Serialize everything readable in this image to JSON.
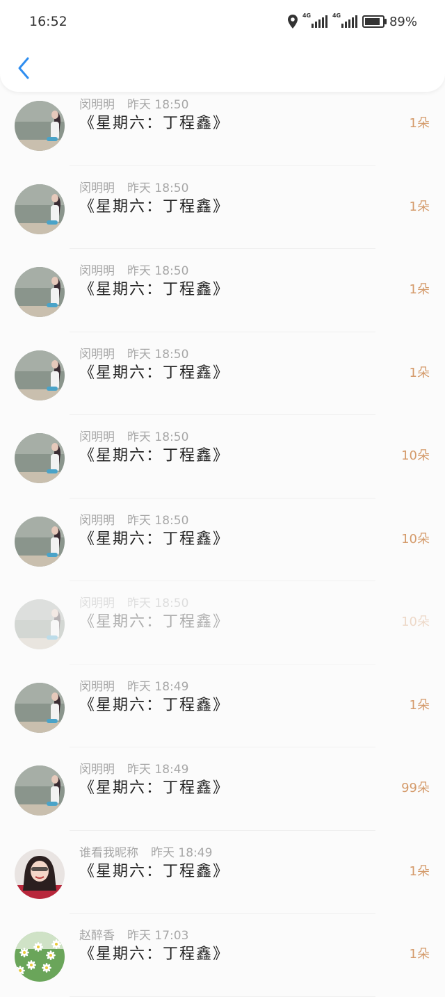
{
  "status": {
    "time": "16:52",
    "net1": "4G",
    "net2": "4G",
    "battery_pct": 89,
    "battery_text": "89%"
  },
  "header": {
    "back_icon": "chevron-left-icon"
  },
  "items": [
    {
      "name": "闵明明",
      "time": "昨天 18:50",
      "title": "《星期六：丁程鑫》",
      "count": "1朵",
      "avatar": "sea-girl"
    },
    {
      "name": "闵明明",
      "time": "昨天 18:50",
      "title": "《星期六：丁程鑫》",
      "count": "1朵",
      "avatar": "sea-girl"
    },
    {
      "name": "闵明明",
      "time": "昨天 18:50",
      "title": "《星期六：丁程鑫》",
      "count": "1朵",
      "avatar": "sea-girl"
    },
    {
      "name": "闵明明",
      "time": "昨天 18:50",
      "title": "《星期六：丁程鑫》",
      "count": "1朵",
      "avatar": "sea-girl"
    },
    {
      "name": "闵明明",
      "time": "昨天 18:50",
      "title": "《星期六：丁程鑫》",
      "count": "10朵",
      "avatar": "sea-girl"
    },
    {
      "name": "闵明明",
      "time": "昨天 18:50",
      "title": "《星期六：丁程鑫》",
      "count": "10朵",
      "avatar": "sea-girl"
    },
    {
      "name": "闵明明",
      "time": "昨天 18:50",
      "title": "《星期六：丁程鑫》",
      "count": "10朵",
      "avatar": "sea-girl",
      "faded": true
    },
    {
      "name": "闵明明",
      "time": "昨天 18:49",
      "title": "《星期六：丁程鑫》",
      "count": "1朵",
      "avatar": "sea-girl"
    },
    {
      "name": "闵明明",
      "time": "昨天 18:49",
      "title": "《星期六：丁程鑫》",
      "count": "99朵",
      "avatar": "sea-girl"
    },
    {
      "name": "谁看我昵称",
      "time": "昨天 18:49",
      "title": "《星期六：丁程鑫》",
      "count": "1朵",
      "avatar": "girl-portrait"
    },
    {
      "name": "赵醉香",
      "time": "昨天 17:03",
      "title": "《星期六：丁程鑫》",
      "count": "1朵",
      "avatar": "daisy-flowers"
    }
  ]
}
